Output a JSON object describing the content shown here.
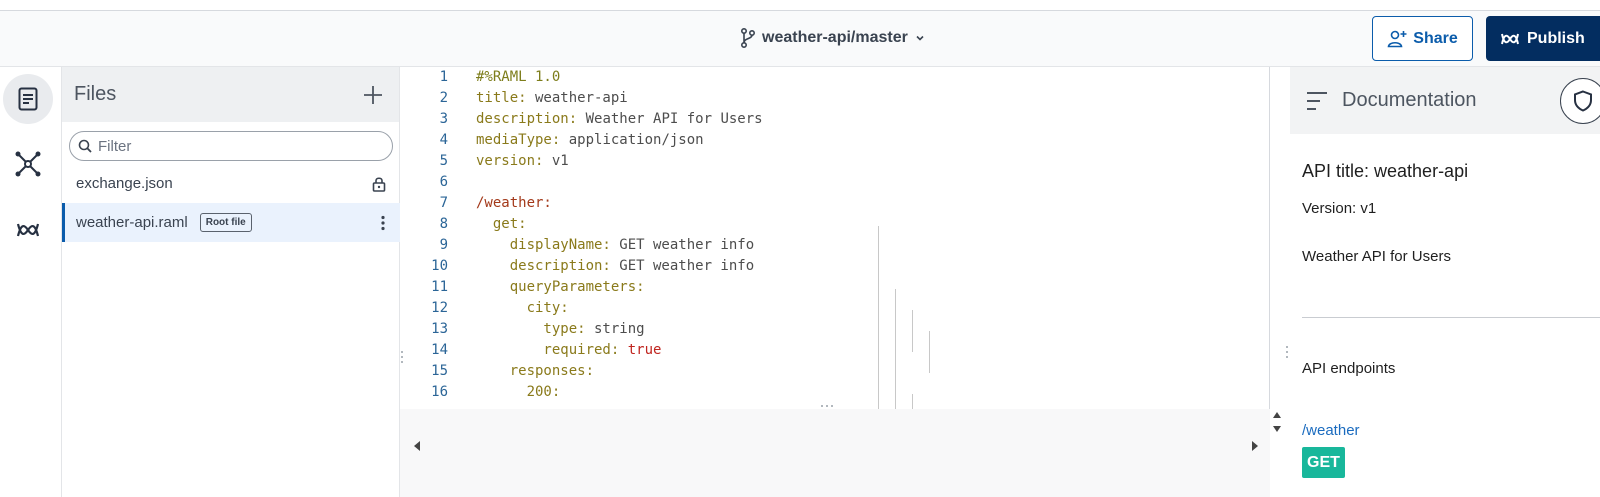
{
  "header": {
    "branch_label": "weather-api/master",
    "share_label": "Share",
    "publish_label": "Publish"
  },
  "files": {
    "title": "Files",
    "filter_placeholder": "Filter",
    "items": [
      {
        "name": "exchange.json",
        "icon": "lock-icon"
      },
      {
        "name": "weather-api.raml",
        "tag": "Root file",
        "icon": "kebab-menu-icon"
      }
    ]
  },
  "editor": {
    "lines": [
      {
        "n": "1",
        "key": "#%RAML 1.0",
        "val": ""
      },
      {
        "n": "2",
        "key": "title:",
        "val": " weather-api"
      },
      {
        "n": "3",
        "key": "description:",
        "val": " Weather API for Users"
      },
      {
        "n": "4",
        "key": "mediaType:",
        "val": " application/json"
      },
      {
        "n": "5",
        "key": "version:",
        "val": " v1"
      },
      {
        "n": "6",
        "key": "",
        "val": ""
      },
      {
        "n": "7",
        "key": "/weather:",
        "val": ""
      },
      {
        "n": "8",
        "key": "  get:",
        "val": ""
      },
      {
        "n": "9",
        "key": "    displayName:",
        "val": " GET weather info"
      },
      {
        "n": "10",
        "key": "    description:",
        "val": " GET weather info"
      },
      {
        "n": "11",
        "key": "    queryParameters:",
        "val": ""
      },
      {
        "n": "12",
        "key": "      city:",
        "val": ""
      },
      {
        "n": "13",
        "key": "        type:",
        "val": " string"
      },
      {
        "n": "14",
        "key": "        required:",
        "val": " true"
      },
      {
        "n": "15",
        "key": "    responses:",
        "val": ""
      },
      {
        "n": "16",
        "key": "      200:",
        "val": ""
      }
    ]
  },
  "docs": {
    "title": "Documentation",
    "api_title": "API title: weather-api",
    "version": "Version: v1",
    "description": "Weather API for Users",
    "endpoints_heading": "API endpoints",
    "endpoint_path": "/weather",
    "method": "GET"
  },
  "colors": {
    "primary": "#0b5cab",
    "publish_bg": "#032d60",
    "get_badge": "#18b79b"
  }
}
